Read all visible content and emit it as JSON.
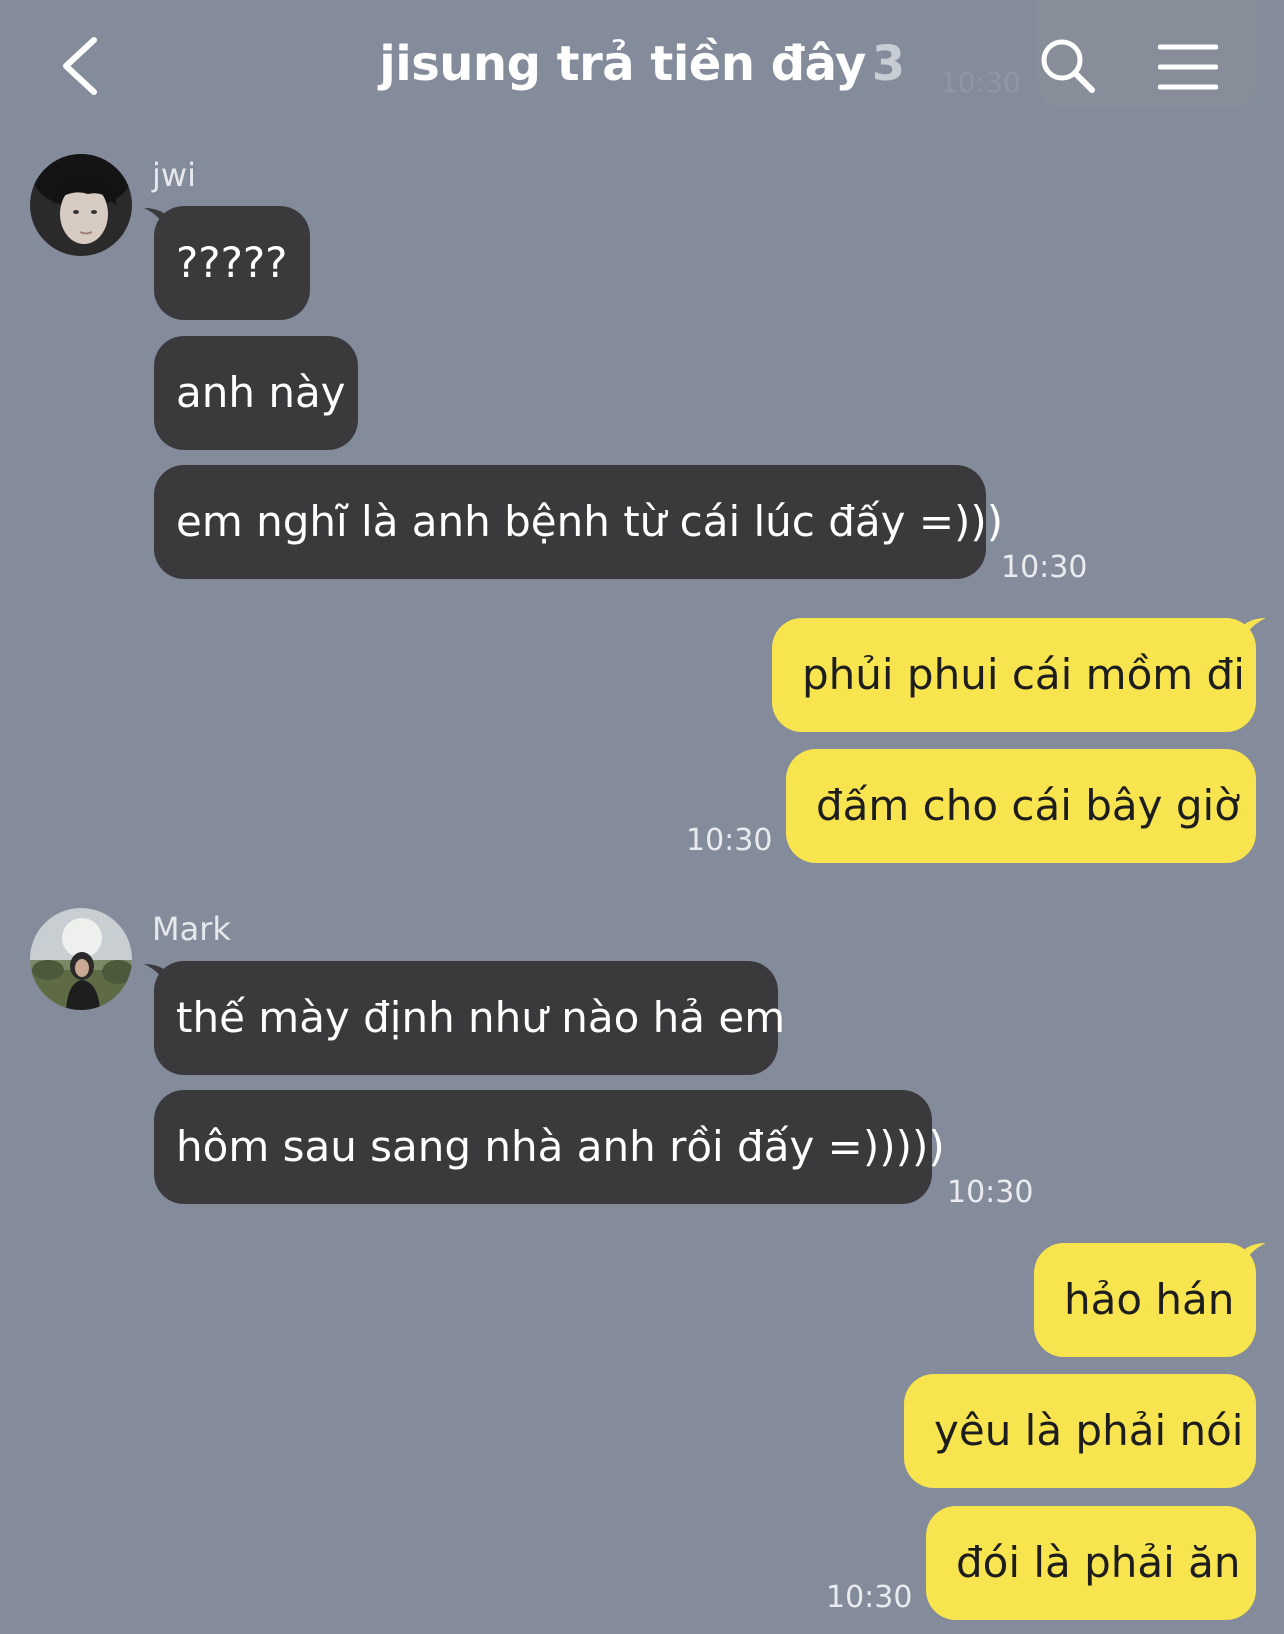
{
  "header": {
    "title": "jisung trả tiền đây",
    "member_count": "3",
    "ghost_time": "10:30"
  },
  "icons": {
    "back": "chevron-left-icon",
    "search": "search-icon",
    "menu": "hamburger-menu-icon"
  },
  "colors": {
    "background": "#848b9a",
    "incoming_bubble": "#3a3a3c",
    "outgoing_bubble": "#f7e44e"
  },
  "messages": {
    "group1": {
      "sender": "jwi",
      "lines": [
        "?????",
        "anh này",
        "em nghĩ là anh bệnh từ cái lúc đấy =)))"
      ],
      "time": "10:30"
    },
    "group2": {
      "lines": [
        "phủi phui cái mồm đi",
        "đấm cho cái bây giờ"
      ],
      "time": "10:30"
    },
    "group3": {
      "sender": "Mark",
      "lines": [
        "thế mày định như nào hả em",
        "hôm sau sang nhà anh rồi đấy =)))))"
      ],
      "time": "10:30"
    },
    "group4": {
      "lines": [
        "hảo hán",
        "yêu là phải nói",
        "đói là phải ăn"
      ],
      "time": "10:30"
    }
  }
}
